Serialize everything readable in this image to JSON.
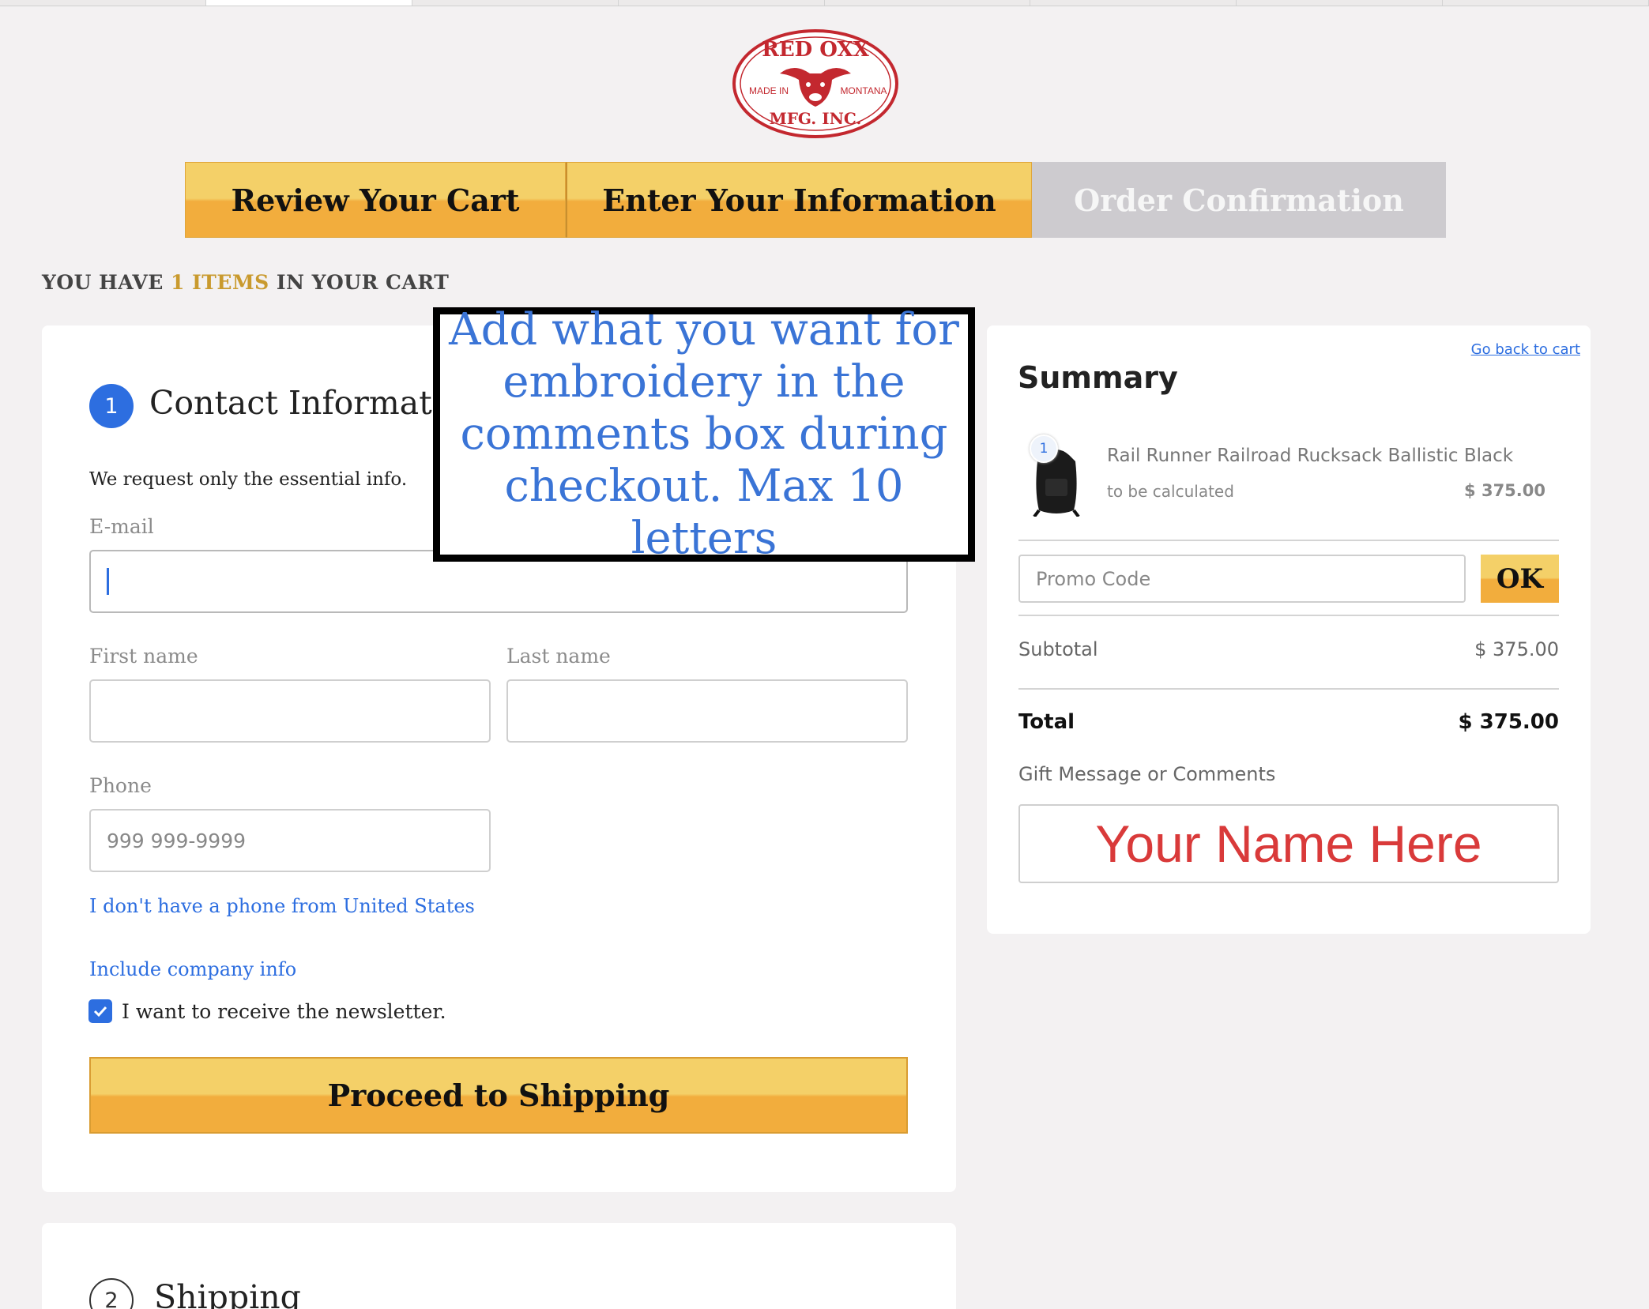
{
  "browser_tabs": 8,
  "brand": {
    "logo_top": "RED OXX",
    "logo_left": "MADE IN",
    "logo_right": "MONTANA",
    "logo_bottom": "MFG. INC.",
    "color": "#c3282f"
  },
  "steps": [
    {
      "label": "Review Your Cart",
      "state": "done"
    },
    {
      "label": "Enter Your Information",
      "state": "current"
    },
    {
      "label": "Order Confirmation",
      "state": "pending"
    }
  ],
  "cart_count": {
    "prefix": "YOU HAVE",
    "count": "1 ITEMS",
    "suffix": "IN YOUR CART"
  },
  "contact": {
    "number": "1",
    "title": "Contact Information",
    "intro": "We request only the essential info.",
    "email_label": "E-mail",
    "first_name_label": "First name",
    "last_name_label": "Last name",
    "phone_label": "Phone",
    "phone_placeholder": "999 999-9999",
    "no_phone_link": "I don't have a phone from United States",
    "company_link": "Include company info",
    "newsletter_label": "I want to receive the newsletter.",
    "newsletter_checked": true,
    "proceed_label": "Proceed to Shipping"
  },
  "shipping": {
    "number": "2",
    "title": "Shipping"
  },
  "annotation": {
    "text": "Add what you want for embroidery in the comments box during checkout. Max 10 letters"
  },
  "summary": {
    "back_link": "Go back to cart",
    "title": "Summary",
    "item": {
      "qty": "1",
      "name": "Rail Runner Railroad Rucksack Ballistic Black",
      "shipping_note": "to be calculated",
      "price": "$ 375.00"
    },
    "promo_placeholder": "Promo Code",
    "promo_button": "OK",
    "subtotal_label": "Subtotal",
    "subtotal_value": "$ 375.00",
    "total_label": "Total",
    "total_value": "$ 375.00",
    "gift_label": "Gift Message or Comments",
    "gift_value": "Your Name Here"
  },
  "colors": {
    "accent": "#2d6ee0",
    "button_top": "#f4d068",
    "button_bottom": "#f2ad3d",
    "gift_text": "#d93a3a"
  }
}
